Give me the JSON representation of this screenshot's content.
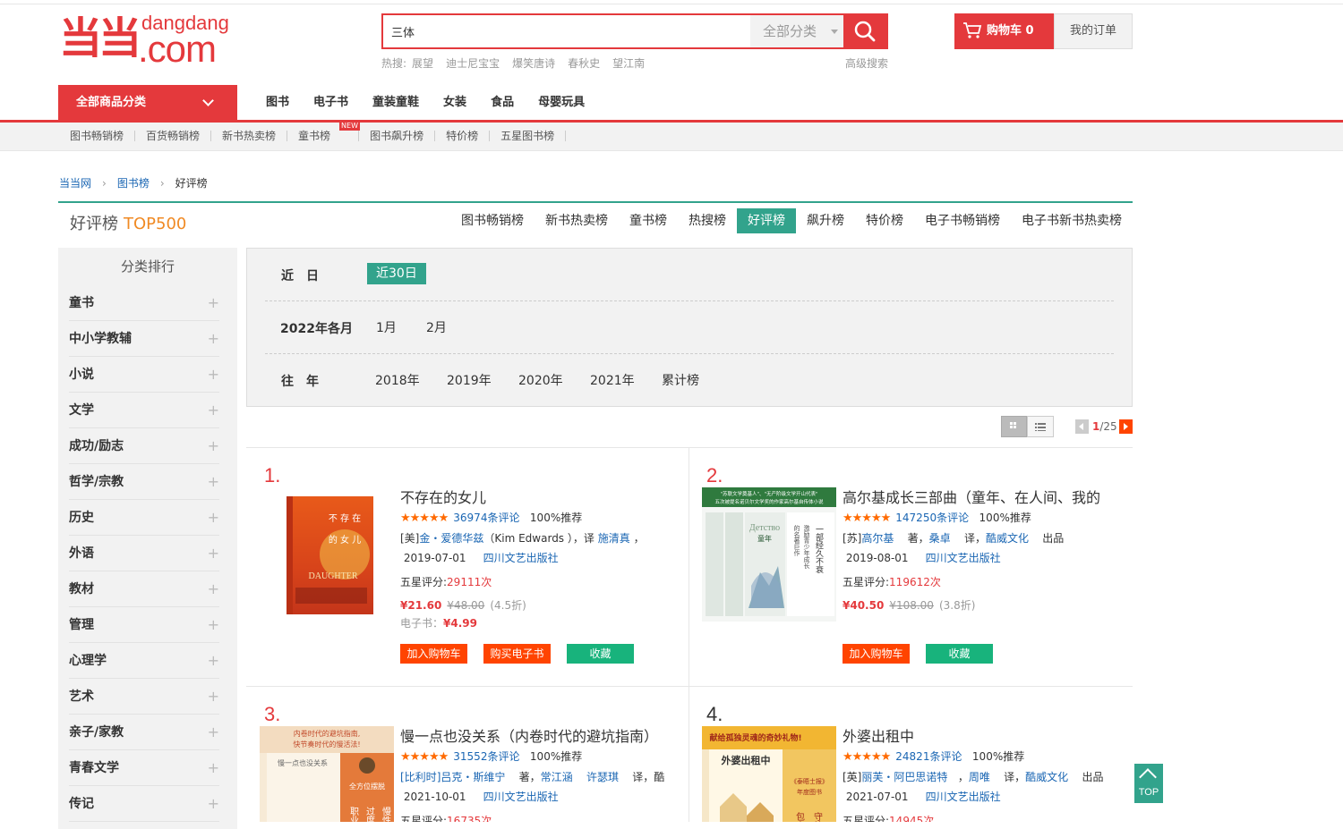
{
  "brand": {
    "logo_text_top": "dangdang",
    "logo_text_main": ".com",
    "logo_mark": "当当"
  },
  "search": {
    "value": "三体",
    "category": "全部分类",
    "hot_label": "热搜:",
    "hot_terms": [
      "展望",
      "迪士尼宝宝",
      "爆笑唐诗",
      "春秋史",
      "望江南"
    ],
    "advanced": "高级搜索"
  },
  "header": {
    "cart_label": "购物车",
    "cart_count": "0",
    "orders_label": "我的订单"
  },
  "nav": {
    "all_label": "全部商品分类",
    "items": [
      "图书",
      "电子书",
      "童装童鞋",
      "女装",
      "食品",
      "母婴玩具"
    ]
  },
  "subnav": {
    "items": [
      "图书畅销榜",
      "百货畅销榜",
      "新书热卖榜",
      "童书榜",
      "图书飙升榜",
      "特价榜",
      "五星图书榜"
    ],
    "new_badge": "NEW"
  },
  "breadcrumb": [
    "当当网",
    "图书榜",
    "好评榜"
  ],
  "rank": {
    "title": "好评榜",
    "subtitle": "TOP500",
    "tabs": [
      "图书畅销榜",
      "新书热卖榜",
      "童书榜",
      "热搜榜",
      "好评榜",
      "飙升榜",
      "特价榜",
      "电子书畅销榜",
      "电子书新书热卖榜"
    ],
    "active_tab": "好评榜"
  },
  "sidebar": {
    "title": "分类排行",
    "items": [
      "童书",
      "中小学教辅",
      "小说",
      "文学",
      "成功/励志",
      "哲学/宗教",
      "历史",
      "外语",
      "教材",
      "管理",
      "心理学",
      "艺术",
      "亲子/家教",
      "青春文学",
      "传记"
    ]
  },
  "filter": {
    "recent_label": "近　日",
    "recent_option": "近30日",
    "month_label": "2022年各月",
    "months": [
      "1月",
      "2月"
    ],
    "years_label": "往　年",
    "years": [
      "2018年",
      "2019年",
      "2020年",
      "2021年",
      "累计榜"
    ]
  },
  "pager": {
    "current": "1",
    "total": "/25"
  },
  "products": [
    {
      "rank": "1.",
      "title": "不存在的女儿",
      "reviews": "36974条评论",
      "recommend": "100%推荐",
      "author_prefix": "[美]",
      "author": "金・爱德华兹",
      "author_orig": "（Kim Edwards ）",
      "translate_sep": "，译",
      "translator": "施清真",
      "translate_suffix": "，",
      "date": "2019-07-01",
      "publisher": "四川文艺出版社",
      "five_star_label": "五星评分:",
      "five_star": "29111次",
      "price": "¥21.60",
      "orig_price": "¥48.00",
      "discount": "(4.5折)",
      "ebook_label": "电子书：",
      "ebook_price": "¥4.99",
      "btn_cart": "加入购物车",
      "btn_ebook": "购买电子书",
      "btn_fav": "收藏",
      "cover_text": "不存在的女儿",
      "cover_en": "DAUGHTER"
    },
    {
      "rank": "2.",
      "title": "高尔基成长三部曲（童年、在人间、我的",
      "reviews": "147250条评论",
      "recommend": "100%推荐",
      "author_prefix": "[苏]",
      "author": "高尔基",
      "author_orig": "著，",
      "translate_sep": "",
      "translator": "桑卓",
      "translate_suffix": "译，",
      "publisher_brand": "酷威文化",
      "brand_suffix": "出品",
      "date": "2019-08-01",
      "publisher": "四川文艺出版社",
      "five_star_label": "五星评分:",
      "five_star": "119612次",
      "price": "¥40.50",
      "orig_price": "¥108.00",
      "discount": "(3.8折)",
      "btn_cart": "加入购物车",
      "btn_fav": "收藏",
      "cover_text": "童年",
      "cover_band": "\"苏联文学奠基人\"、\"无产阶级文学开山代表\""
    },
    {
      "rank": "3.",
      "title": "慢一点也没关系（内卷时代的避坑指南）",
      "reviews": "31552条评论",
      "recommend": "100%推荐",
      "author_prefix": "[比利时",
      "author": "]吕克・斯维宁",
      "author_orig": "著，",
      "translator": "常江涵",
      "translator2": "许瑟琪",
      "translate_suffix": "译，酷",
      "date": "2021-10-01",
      "publisher": "四川文艺出版社",
      "five_star_label": "五星评分:",
      "five_star": "16735次",
      "cover_text": "内卷时代的避坑指南，快节奏时代的慢活法!",
      "cover_sub": "慢一点也没关系"
    },
    {
      "rank": "4.",
      "title": "外婆出租中",
      "reviews": "24821条评论",
      "recommend": "100%推荐",
      "author_prefix": "[英]",
      "author": "丽芙・阿巴思诺特",
      "author_orig": "，",
      "translator": "周唯",
      "translate_suffix": "译，",
      "publisher_brand": "酷威文化",
      "brand_suffix": "出品",
      "date": "2021-07-01",
      "publisher": "四川文艺出版社",
      "five_star_label": "五星评分:",
      "five_star": "14945次",
      "cover_text": "献给孤独灵魂的奇妙礼物!",
      "cover_sub": "外婆出租中"
    }
  ],
  "to_top": "TOP",
  "colors": {
    "brand_red": "#e4393c",
    "accent_green": "#32a38c",
    "button_orange": "#ff4400",
    "button_green": "#18b37c",
    "star_orange": "#ff6a00"
  },
  "icons": {
    "search": "search-icon",
    "cart": "cart-icon",
    "grid": "grid-view-icon",
    "list": "list-view-icon"
  }
}
